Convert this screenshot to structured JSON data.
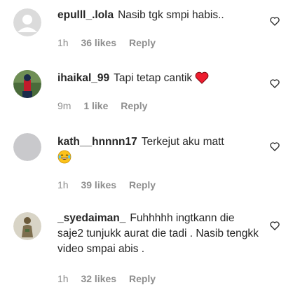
{
  "comments": [
    {
      "username": "epulll_.lola",
      "text": "Nasib tgk smpi habis..",
      "time": "1h",
      "likes": "36 likes",
      "reply": "Reply",
      "avatar": "default-gray-avatar-icon"
    },
    {
      "username": "ihaikal_99",
      "text": "Tapi tetap cantik",
      "emoji": "red-heart-emoji",
      "time": "9m",
      "likes": "1 like",
      "reply": "Reply",
      "avatar": "user-photo"
    },
    {
      "username": "kath__hnnnn17",
      "text": "Terkejut aku matt",
      "emoji": "laughing-tears-emoji",
      "time": "1h",
      "likes": "39 likes",
      "reply": "Reply",
      "avatar": "gray-avatar"
    },
    {
      "username": "_syedaiman_",
      "text": "Fuhhhhh ingtkann die saje2 tunjukk aurat die tadi . Nasib tengkk video smpai abis .",
      "time": "1h",
      "likes": "32 likes",
      "reply": "Reply",
      "avatar": "user-photo"
    }
  ],
  "colors": {
    "text": "#262626",
    "meta": "#8e8e8e",
    "heart_emoji": "#ed1c2e"
  },
  "icons": {
    "like": "heart-outline-icon"
  }
}
